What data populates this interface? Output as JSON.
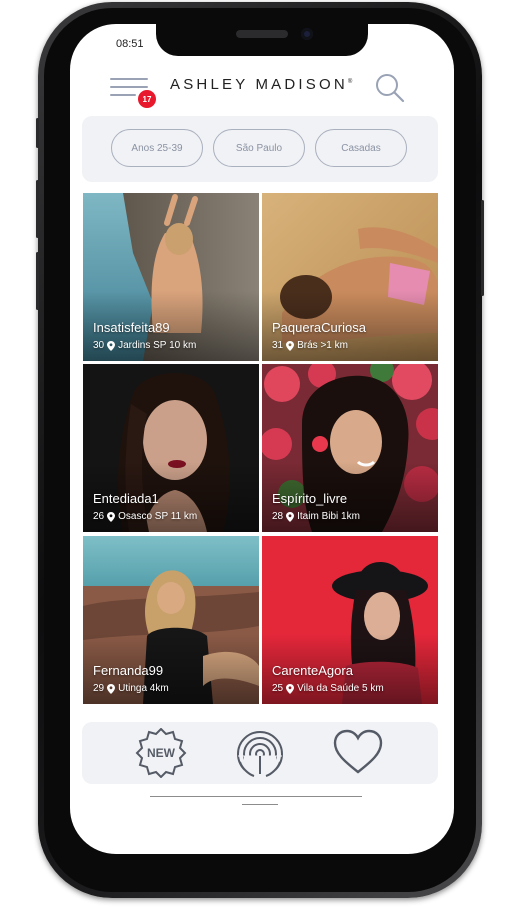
{
  "status_bar": {
    "time": "08:51"
  },
  "header": {
    "logo_text": "ASHLEY MADISON",
    "notification_count": "17"
  },
  "filters": [
    {
      "label": "Anos 25-39"
    },
    {
      "label": "São Paulo"
    },
    {
      "label": "Casadas"
    }
  ],
  "profiles": [
    {
      "name": "Insatisfeita89",
      "age": "30",
      "location": "Jardins SP 10 km"
    },
    {
      "name": "PaqueraCuriosa",
      "age": "31",
      "location": "Brás  >1 km"
    },
    {
      "name": "Entediada1",
      "age": "26",
      "location": "Osasco SP 11 km"
    },
    {
      "name": "Espírito_livre",
      "age": "28",
      "location": "Itaim Bibi 1km"
    },
    {
      "name": "Fernanda99",
      "age": "29",
      "location": "Utinga 4km"
    },
    {
      "name": "CarenteAgora",
      "age": "25",
      "location": "Vila da Saúde 5 km"
    }
  ],
  "bottom_nav": [
    {
      "label": "NEW",
      "icon": "new-badge-icon"
    },
    {
      "icon": "radar-icon"
    },
    {
      "icon": "heart-icon"
    }
  ],
  "colors": {
    "accent_badge": "#e8192c",
    "chip_border": "#a9b0be",
    "panel_bg": "#f1f2f5",
    "icon_gray": "#555b66"
  }
}
